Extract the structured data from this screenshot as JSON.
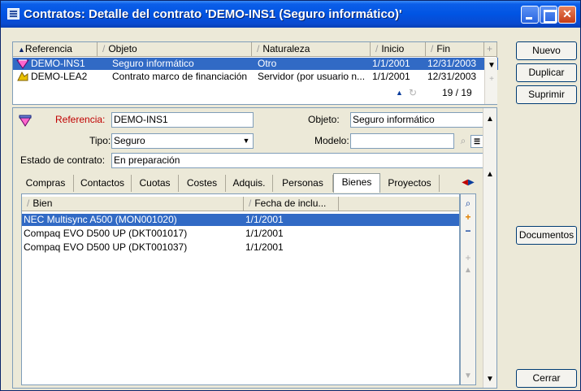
{
  "window": {
    "title": "Contratos: Detalle del contrato 'DEMO-INS1 (Seguro informático)'"
  },
  "top_list": {
    "columns": [
      "Referencia",
      "Objeto",
      "Naturaleza",
      "Inicio",
      "Fin"
    ],
    "rows": [
      {
        "ref": "DEMO-INS1",
        "obj": "Seguro informático",
        "nat": "Otro",
        "inicio": "1/1/2001",
        "fin": "12/31/2003"
      },
      {
        "ref": "DEMO-LEA2",
        "obj": "Contrato marco de financiación",
        "nat": "Servidor (por usuario n...",
        "inicio": "1/1/2001",
        "fin": "12/31/2003"
      }
    ],
    "counter": "19 / 19"
  },
  "side_buttons": {
    "nuevo": "Nuevo",
    "duplicar": "Duplicar",
    "suprimir": "Suprimir",
    "documentos": "Documentos",
    "cerrar": "Cerrar"
  },
  "form": {
    "referencia_label": "Referencia:",
    "referencia_value": "DEMO-INS1",
    "objeto_label": "Objeto:",
    "objeto_value": "Seguro informático",
    "tipo_label": "Tipo:",
    "tipo_value": "Seguro",
    "modelo_label": "Modelo:",
    "modelo_value": "",
    "estado_label": "Estado de contrato:",
    "estado_value": "En preparación"
  },
  "tabs": [
    "Compras",
    "Contactos",
    "Cuotas",
    "Costes",
    "Adquis.",
    "Personas",
    "Bienes",
    "Proyectos"
  ],
  "active_tab": "Bienes",
  "bienes_list": {
    "columns": [
      "Bien",
      "Fecha de inclu..."
    ],
    "rows": [
      {
        "bien": "NEC Multisync A500 (MON001020)",
        "fecha": "1/1/2001"
      },
      {
        "bien": "Compaq EVO D500 UP (DKT001017)",
        "fecha": "1/1/2001"
      },
      {
        "bien": "Compaq EVO D500 UP (DKT001037)",
        "fecha": "1/1/2001"
      }
    ]
  },
  "colors": {
    "selection": "#316ac5",
    "title_bar": "#0054e3",
    "referencia_label": "#c00000"
  }
}
